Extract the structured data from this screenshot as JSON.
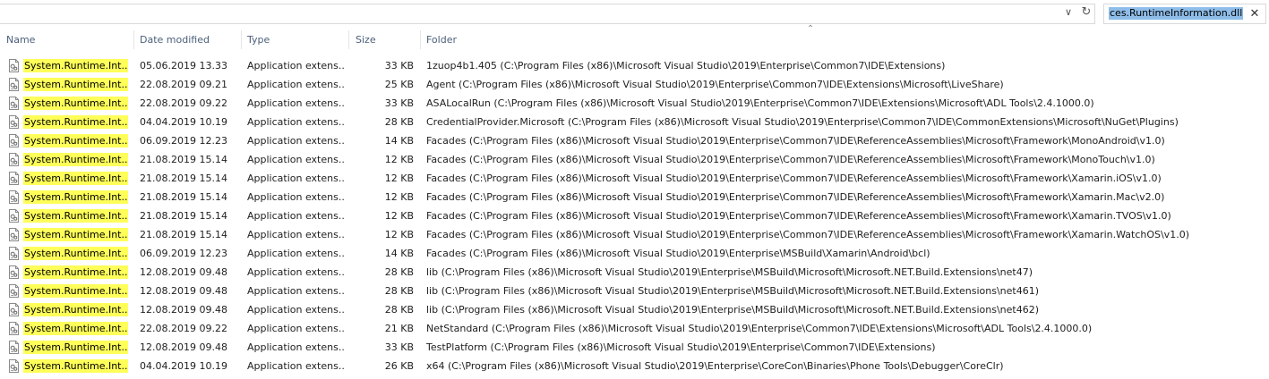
{
  "toolbar": {
    "dropdown_icon": "chevron-down-icon",
    "refresh_icon": "refresh-icon"
  },
  "search": {
    "value": "ces.RuntimeInformation.dll",
    "clear_icon": "close-icon"
  },
  "columns": {
    "name": "Name",
    "date": "Date modified",
    "type": "Type",
    "size": "Size",
    "folder": "Folder"
  },
  "colors": {
    "highlight": "#ffff5a",
    "header_text": "#4c607a",
    "selection": "#8ebde9"
  },
  "rows": [
    {
      "name": "System.Runtime.Int...",
      "date": "05.06.2019 13.33",
      "type": "Application extens...",
      "size": "33 KB",
      "folder": "1zuop4b1.405 (C:\\Program Files (x86)\\Microsoft Visual Studio\\2019\\Enterprise\\Common7\\IDE\\Extensions)"
    },
    {
      "name": "System.Runtime.Int...",
      "date": "22.08.2019 09.21",
      "type": "Application extens...",
      "size": "25 KB",
      "folder": "Agent (C:\\Program Files (x86)\\Microsoft Visual Studio\\2019\\Enterprise\\Common7\\IDE\\Extensions\\Microsoft\\LiveShare)"
    },
    {
      "name": "System.Runtime.Int...",
      "date": "22.08.2019 09.22",
      "type": "Application extens...",
      "size": "33 KB",
      "folder": "ASALocalRun (C:\\Program Files (x86)\\Microsoft Visual Studio\\2019\\Enterprise\\Common7\\IDE\\Extensions\\Microsoft\\ADL Tools\\2.4.1000.0)"
    },
    {
      "name": "System.Runtime.Int...",
      "date": "04.04.2019 10.19",
      "type": "Application extens...",
      "size": "28 KB",
      "folder": "CredentialProvider.Microsoft (C:\\Program Files (x86)\\Microsoft Visual Studio\\2019\\Enterprise\\Common7\\IDE\\CommonExtensions\\Microsoft\\NuGet\\Plugins)"
    },
    {
      "name": "System.Runtime.Int...",
      "date": "06.09.2019 12.23",
      "type": "Application extens...",
      "size": "14 KB",
      "folder": "Facades (C:\\Program Files (x86)\\Microsoft Visual Studio\\2019\\Enterprise\\Common7\\IDE\\ReferenceAssemblies\\Microsoft\\Framework\\MonoAndroid\\v1.0)"
    },
    {
      "name": "System.Runtime.Int...",
      "date": "21.08.2019 15.14",
      "type": "Application extens...",
      "size": "12 KB",
      "folder": "Facades (C:\\Program Files (x86)\\Microsoft Visual Studio\\2019\\Enterprise\\Common7\\IDE\\ReferenceAssemblies\\Microsoft\\Framework\\MonoTouch\\v1.0)"
    },
    {
      "name": "System.Runtime.Int...",
      "date": "21.08.2019 15.14",
      "type": "Application extens...",
      "size": "12 KB",
      "folder": "Facades (C:\\Program Files (x86)\\Microsoft Visual Studio\\2019\\Enterprise\\Common7\\IDE\\ReferenceAssemblies\\Microsoft\\Framework\\Xamarin.iOS\\v1.0)"
    },
    {
      "name": "System.Runtime.Int...",
      "date": "21.08.2019 15.14",
      "type": "Application extens...",
      "size": "12 KB",
      "folder": "Facades (C:\\Program Files (x86)\\Microsoft Visual Studio\\2019\\Enterprise\\Common7\\IDE\\ReferenceAssemblies\\Microsoft\\Framework\\Xamarin.Mac\\v2.0)"
    },
    {
      "name": "System.Runtime.Int...",
      "date": "21.08.2019 15.14",
      "type": "Application extens...",
      "size": "12 KB",
      "folder": "Facades (C:\\Program Files (x86)\\Microsoft Visual Studio\\2019\\Enterprise\\Common7\\IDE\\ReferenceAssemblies\\Microsoft\\Framework\\Xamarin.TVOS\\v1.0)"
    },
    {
      "name": "System.Runtime.Int...",
      "date": "21.08.2019 15.14",
      "type": "Application extens...",
      "size": "12 KB",
      "folder": "Facades (C:\\Program Files (x86)\\Microsoft Visual Studio\\2019\\Enterprise\\Common7\\IDE\\ReferenceAssemblies\\Microsoft\\Framework\\Xamarin.WatchOS\\v1.0)"
    },
    {
      "name": "System.Runtime.Int...",
      "date": "06.09.2019 12.23",
      "type": "Application extens...",
      "size": "14 KB",
      "folder": "Facades (C:\\Program Files (x86)\\Microsoft Visual Studio\\2019\\Enterprise\\MSBuild\\Xamarin\\Android\\bcl)"
    },
    {
      "name": "System.Runtime.Int...",
      "date": "12.08.2019 09.48",
      "type": "Application extens...",
      "size": "28 KB",
      "folder": "lib (C:\\Program Files (x86)\\Microsoft Visual Studio\\2019\\Enterprise\\MSBuild\\Microsoft\\Microsoft.NET.Build.Extensions\\net47)"
    },
    {
      "name": "System.Runtime.Int...",
      "date": "12.08.2019 09.48",
      "type": "Application extens...",
      "size": "28 KB",
      "folder": "lib (C:\\Program Files (x86)\\Microsoft Visual Studio\\2019\\Enterprise\\MSBuild\\Microsoft\\Microsoft.NET.Build.Extensions\\net461)"
    },
    {
      "name": "System.Runtime.Int...",
      "date": "12.08.2019 09.48",
      "type": "Application extens...",
      "size": "28 KB",
      "folder": "lib (C:\\Program Files (x86)\\Microsoft Visual Studio\\2019\\Enterprise\\MSBuild\\Microsoft\\Microsoft.NET.Build.Extensions\\net462)"
    },
    {
      "name": "System.Runtime.Int...",
      "date": "22.08.2019 09.22",
      "type": "Application extens...",
      "size": "21 KB",
      "folder": "NetStandard (C:\\Program Files (x86)\\Microsoft Visual Studio\\2019\\Enterprise\\Common7\\IDE\\Extensions\\Microsoft\\ADL Tools\\2.4.1000.0)"
    },
    {
      "name": "System.Runtime.Int...",
      "date": "12.08.2019 09.48",
      "type": "Application extens...",
      "size": "33 KB",
      "folder": "TestPlatform (C:\\Program Files (x86)\\Microsoft Visual Studio\\2019\\Enterprise\\Common7\\IDE\\Extensions)"
    },
    {
      "name": "System.Runtime.Int...",
      "date": "04.04.2019 10.19",
      "type": "Application extens...",
      "size": "26 KB",
      "folder": "x64 (C:\\Program Files (x86)\\Microsoft Visual Studio\\2019\\Enterprise\\CoreCon\\Binaries\\Phone Tools\\Debugger\\CoreClr)"
    }
  ]
}
